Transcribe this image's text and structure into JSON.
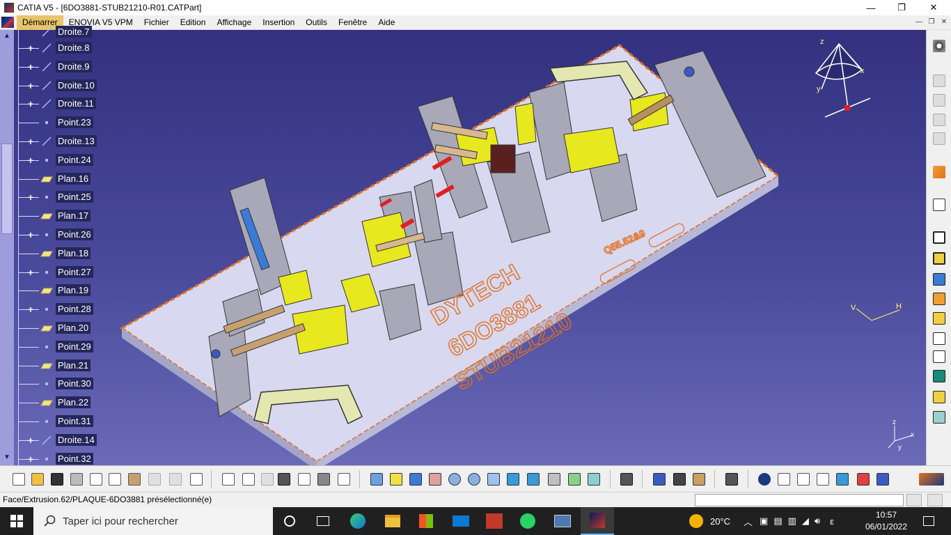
{
  "window": {
    "title": "CATIA V5 - [6DO3881-STUB21210-R01.CATPart]",
    "controls": {
      "minimize": "—",
      "maximize": "❐",
      "close": "✕"
    }
  },
  "menu": {
    "items": [
      "Démarrer",
      "ENOVIA V5 VPM",
      "Fichier",
      "Edition",
      "Affichage",
      "Insertion",
      "Outils",
      "Fenêtre",
      "Aide"
    ],
    "active": "Démarrer"
  },
  "tree": {
    "partial_top": "Droite.7",
    "nodes": [
      {
        "label": "Droite.8",
        "icon": "line-icon",
        "expandable": true
      },
      {
        "label": "Droite.9",
        "icon": "line-icon",
        "expandable": true
      },
      {
        "label": "Droite.10",
        "icon": "line-icon",
        "expandable": true
      },
      {
        "label": "Droite.11",
        "icon": "line-icon",
        "expandable": true
      },
      {
        "label": "Point.23",
        "icon": "point-icon",
        "expandable": false
      },
      {
        "label": "Droite.13",
        "icon": "line-icon",
        "expandable": true
      },
      {
        "label": "Point.24",
        "icon": "point-icon",
        "expandable": true
      },
      {
        "label": "Plan.16",
        "icon": "plane-icon",
        "expandable": false
      },
      {
        "label": "Point.25",
        "icon": "point-icon",
        "expandable": true
      },
      {
        "label": "Plan.17",
        "icon": "plane-icon",
        "expandable": false
      },
      {
        "label": "Point.26",
        "icon": "point-icon",
        "expandable": true
      },
      {
        "label": "Plan.18",
        "icon": "plane-icon",
        "expandable": false
      },
      {
        "label": "Point.27",
        "icon": "point-icon",
        "expandable": true
      },
      {
        "label": "Plan.19",
        "icon": "plane-icon",
        "expandable": false
      },
      {
        "label": "Point.28",
        "icon": "point-icon",
        "expandable": true
      },
      {
        "label": "Plan.20",
        "icon": "plane-icon",
        "expandable": false
      },
      {
        "label": "Point.29",
        "icon": "point-icon",
        "expandable": false
      },
      {
        "label": "Plan.21",
        "icon": "plane-icon",
        "expandable": false
      },
      {
        "label": "Point.30",
        "icon": "point-icon",
        "expandable": false
      },
      {
        "label": "Plan.22",
        "icon": "plane-icon",
        "expandable": false
      },
      {
        "label": "Point.31",
        "icon": "point-icon",
        "expandable": false
      },
      {
        "label": "Droite.14",
        "icon": "line-icon",
        "expandable": true
      },
      {
        "label": "Point.32",
        "icon": "point-icon",
        "expandable": true
      }
    ]
  },
  "model": {
    "engraving": [
      "DYTECH",
      "6DO3881",
      "STUB21210"
    ],
    "small_engraving": "Q55.52&9"
  },
  "compass": {
    "x": "x",
    "y": "y",
    "z": "z"
  },
  "axis_triad": {
    "x": "x",
    "y": "y",
    "z": "z"
  },
  "small_axes": {
    "v": "V",
    "h": "H"
  },
  "status": {
    "message": "Face/Extrusion.62/PLAQUE-6DO3881 présélectionné(e)"
  },
  "taskbar": {
    "search_placeholder": "Taper ici pour rechercher",
    "weather": "20°C",
    "time": "10:57",
    "date": "06/01/2022",
    "lang": "ε"
  },
  "colors": {
    "viewport_top": "#33317f",
    "viewport_bottom": "#6a6ab8",
    "plate": "#d8d8f0",
    "plate_edge": "#e07020",
    "engraving": "#e07020",
    "yellow_part": "#e8e81e",
    "grey_part": "#a8a8b8"
  }
}
